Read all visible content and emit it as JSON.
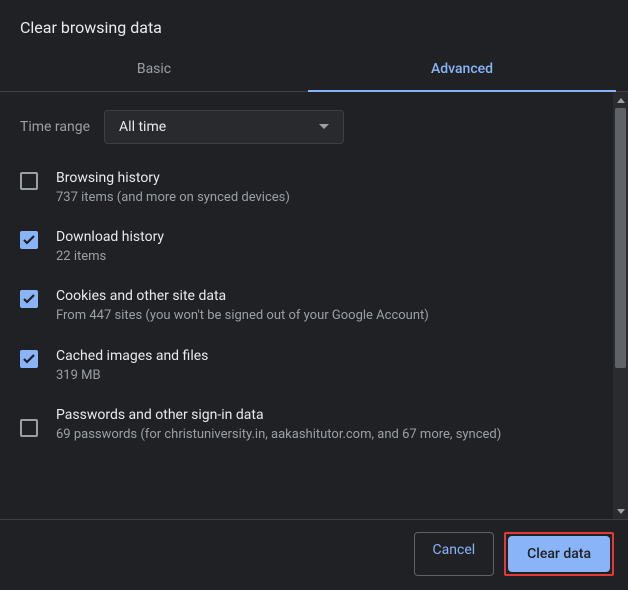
{
  "title": "Clear browsing data",
  "tabs": {
    "basic": "Basic",
    "advanced": "Advanced"
  },
  "timeRange": {
    "label": "Time range",
    "value": "All time"
  },
  "items": [
    {
      "checked": false,
      "title": "Browsing history",
      "sub": "737 items (and more on synced devices)"
    },
    {
      "checked": true,
      "title": "Download history",
      "sub": "22 items"
    },
    {
      "checked": true,
      "title": "Cookies and other site data",
      "sub": "From 447 sites (you won't be signed out of your Google Account)"
    },
    {
      "checked": true,
      "title": "Cached images and files",
      "sub": "319 MB"
    },
    {
      "checked": false,
      "title": "Passwords and other sign-in data",
      "sub": "69 passwords (for christuniversity.in, aakashitutor.com, and 67 more, synced)"
    }
  ],
  "footer": {
    "cancel": "Cancel",
    "confirm": "Clear data"
  }
}
